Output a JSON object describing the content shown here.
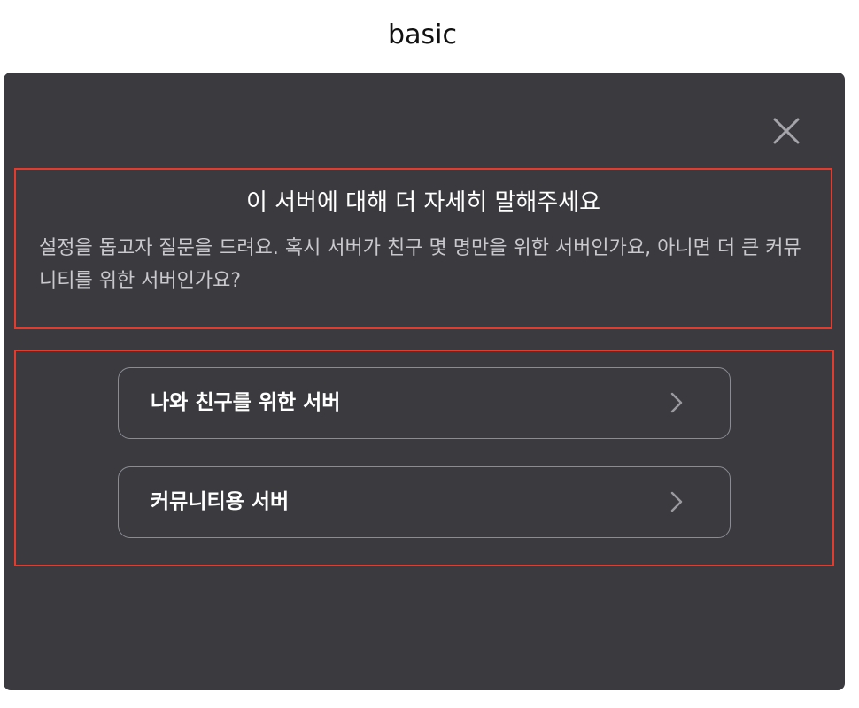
{
  "page": {
    "caption": "basic"
  },
  "modal": {
    "title": "이 서버에 대해 더 자세히 말해주세요",
    "description": "설정을 돕고자 질문을 드려요. 혹시 서버가 친구 몇 명만을 위한 서버인가요, 아니면 더 큰 커뮤니티를 위한 서버인가요?",
    "close_icon": "close-icon",
    "options": [
      {
        "label": "나와 친구를 위한 서버",
        "icon": "chevron-right-icon"
      },
      {
        "label": "커뮤니티용 서버",
        "icon": "chevron-right-icon"
      }
    ]
  },
  "colors": {
    "modal_bg": "#3a3a3f",
    "highlight_border": "#e33b2e",
    "option_border": "#8b8b93",
    "title_text": "#ffffff",
    "desc_text": "#c9c9cd"
  }
}
